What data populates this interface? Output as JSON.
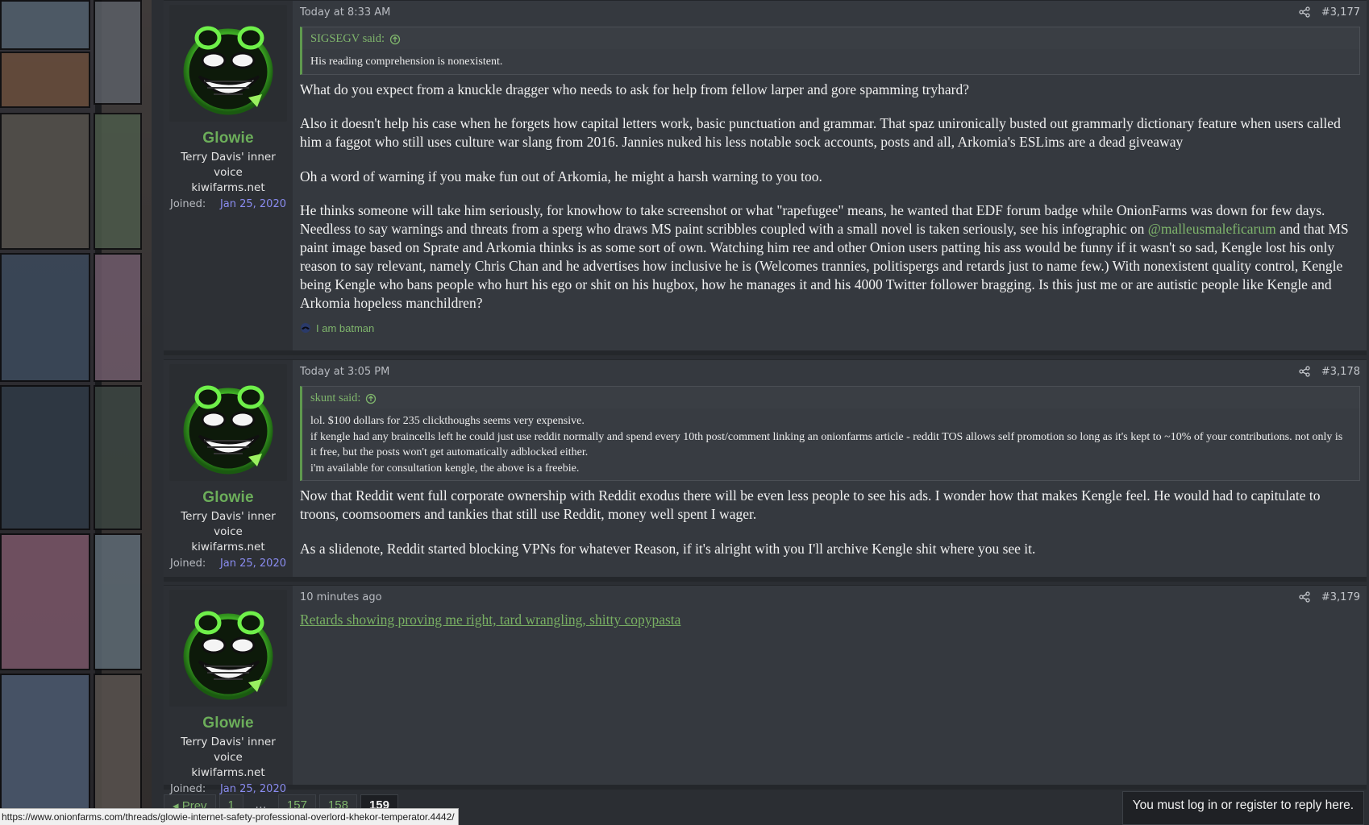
{
  "posts": [
    {
      "user": {
        "name": "Glowie",
        "title": "Terry Davis' inner voice",
        "site": "kiwifarms.net",
        "joined_label": "Joined:",
        "joined_date": "Jan 25, 2020"
      },
      "time": "Today at 8:33 AM",
      "number": "#3,177",
      "quote": {
        "author": "SIGSEGV said:",
        "lines": [
          "His reading comprehension is nonexistent."
        ]
      },
      "paragraphs": [
        "What do you expect from a knuckle dragger who needs to ask for help from fellow larper and gore spamming tryhard?",
        "Also it doesn't help his case when he forgets how capital letters work, basic punctuation and grammar. That spaz unironically busted out grammarly dictionary feature when users called him a faggot who still uses culture war slang from 2016. Jannies nuked his less notable sock accounts, posts and all, Arkomia's ESLims are a dead giveaway",
        "Oh a word of warning if you make fun out of Arkomia, he might a harsh warning to you too."
      ],
      "para4_start": "He thinks someone will take him seriously, for knowhow to take screenshot or what \"rapefugee\" means, he wanted that EDF forum badge while OnionFarms was down for few days. Needless to say warnings and threats from a sperg who draws MS paint scribbles coupled with a small novel is taken seriously, see his infographic on ",
      "mention": "@malleusmaleficarum",
      "para4_end": " and that MS paint image based on Sprate and Arkomia thinks is as some sort of own. Watching him ree and other Onion users patting his ass would be funny if it wasn't so sad, Kengle lost his only reason to say relevant, namely Chris Chan and he advertises how inclusive he is (Welcomes trannies, politispergs and retards just to name few.) With nonexistent quality control, Kengle being Kengle who bans people who hurt his ego or shit on his hugbox, how he manages it and his 4000 Twitter follower bragging. Is this just me or are autistic people like Kengle and Arkomia hopeless manchildren?",
      "reaction": "I am batman"
    },
    {
      "user": {
        "name": "Glowie",
        "title": "Terry Davis' inner voice",
        "site": "kiwifarms.net",
        "joined_label": "Joined:",
        "joined_date": "Jan 25, 2020"
      },
      "time": "Today at 3:05 PM",
      "number": "#3,178",
      "quote": {
        "author": "skunt said:",
        "lines": [
          "lol. $100 dollars for 235 clickthoughs seems very expensive.",
          "if kengle had any braincells left he could just use reddit normally and spend every 10th post/comment linking an onionfarms article - reddit TOS allows self promotion so long as it's kept to ~10% of your contributions. not only is it free, but the posts won't get automatically adblocked either.",
          "i'm available for consultation kengle, the above is a freebie."
        ]
      },
      "paragraphs": [
        "Now that Reddit went full corporate ownership with Reddit exodus there will be even less people to see his ads. I wonder how that makes Kengle feel. He would had to capitulate to troons, coomsoomers and tankies that still use Reddit, money well spent I wager.",
        "As a slidenote, Reddit started blocking VPNs for whatever Reason, if it's alright with you I'll archive Kengle shit where you see it."
      ]
    },
    {
      "user": {
        "name": "Glowie",
        "title": "Terry Davis' inner voice",
        "site": "kiwifarms.net",
        "joined_label": "Joined:",
        "joined_date": "Jan 25, 2020"
      },
      "time": "10 minutes ago",
      "number": "#3,179",
      "link": "Retards showing proving me right, tard wrangling, shitty copypasta"
    }
  ],
  "pagination": {
    "prev": "◂ Prev",
    "pages": [
      "1",
      "…",
      "157",
      "158",
      "159"
    ]
  },
  "login_notice": "You must log in or register to reply here.",
  "status_url": "https://www.onionfarms.com/threads/glowie-internet-safety-professional-overlord-khekor-temperator.4442/",
  "colors": {
    "accent": "#7fb56c",
    "date_link": "#8a8cf0",
    "post_bg": "#35393f"
  },
  "icons": [
    "share-icon",
    "arrow-up-circle-icon",
    "avatar-glowing-troll-face"
  ]
}
